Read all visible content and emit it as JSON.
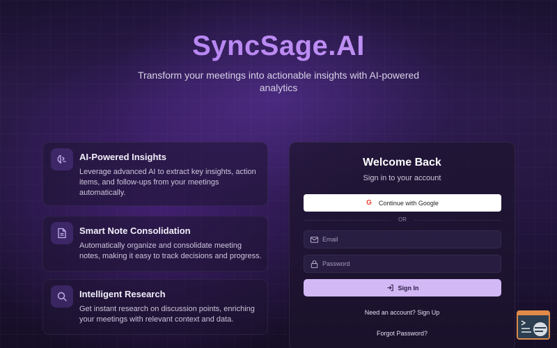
{
  "hero": {
    "brand": "SyncSage.AI",
    "tagline": "Transform your meetings into actionable insights with AI-powered analytics"
  },
  "features": [
    {
      "icon": "brain-icon",
      "title": "AI-Powered Insights",
      "description": "Leverage advanced AI to extract key insights, action items, and follow-ups from your meetings automatically."
    },
    {
      "icon": "document-icon",
      "title": "Smart Note Consolidation",
      "description": "Automatically organize and consolidate meeting notes, making it easy to track decisions and progress."
    },
    {
      "icon": "search-icon",
      "title": "Intelligent Research",
      "description": "Get instant research on discussion points, enriching your meetings with relevant context and data."
    }
  ],
  "auth": {
    "title": "Welcome Back",
    "subtitle": "Sign in to your account",
    "google_label": "Continue with Google",
    "divider": "OR",
    "email_placeholder": "Email",
    "password_placeholder": "Password",
    "signin_label": "Sign In",
    "signup_link": "Need an account? Sign Up",
    "forgot_link": "Forgot Password?"
  },
  "colors": {
    "accent": "#b07cf0",
    "signin_button": "#d2b8f5",
    "background": "#1a1230"
  }
}
